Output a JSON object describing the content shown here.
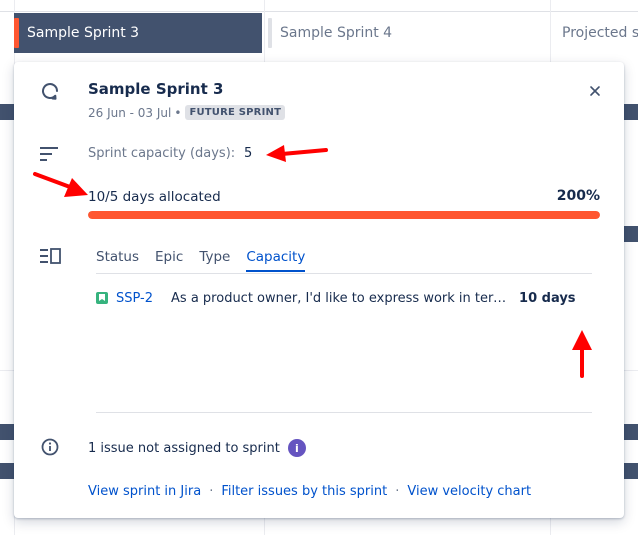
{
  "timeline": {
    "sprints": [
      {
        "label": "Sample Sprint 3"
      },
      {
        "label": "Sample Sprint 4"
      },
      {
        "label": "Projected sp"
      }
    ]
  },
  "popup": {
    "title": "Sample Sprint 3",
    "dates": "26 Jun - 03 Jul",
    "bullet": "•",
    "badge": "FUTURE SPRINT",
    "capacity_label": "Sprint capacity (days):",
    "capacity_value": "5",
    "allocated_text": "10/5 days allocated",
    "allocated_percent": "200%",
    "allocation_fill_fraction": 1.0,
    "tabs": [
      {
        "label": "Status",
        "selected": false
      },
      {
        "label": "Epic",
        "selected": false
      },
      {
        "label": "Type",
        "selected": false
      },
      {
        "label": "Capacity",
        "selected": true
      }
    ],
    "issues": [
      {
        "key": "SSP-2",
        "summary": "As a product owner, I'd like to express work in terms of actual time (hours, minutes, days) to better understand the effort involved",
        "days": "10 days"
      }
    ],
    "unassigned_text": "1 issue not assigned to sprint",
    "info_glyph": "i",
    "links": {
      "view_sprint": "View sprint in Jira",
      "filter_issues": "Filter issues by this sprint",
      "velocity": "View velocity chart",
      "separator": "·"
    }
  },
  "colors": {
    "accent": "#0052cc",
    "danger": "#ff5630",
    "story": "#36b37e",
    "info": "#6554c0",
    "annotation_arrow": "#ff0000"
  },
  "icons": [
    "sprint-cycle-icon",
    "close-icon",
    "capacity-lines-icon",
    "breakdown-list-icon",
    "story-icon",
    "info-circle-icon",
    "info-badge-icon"
  ]
}
